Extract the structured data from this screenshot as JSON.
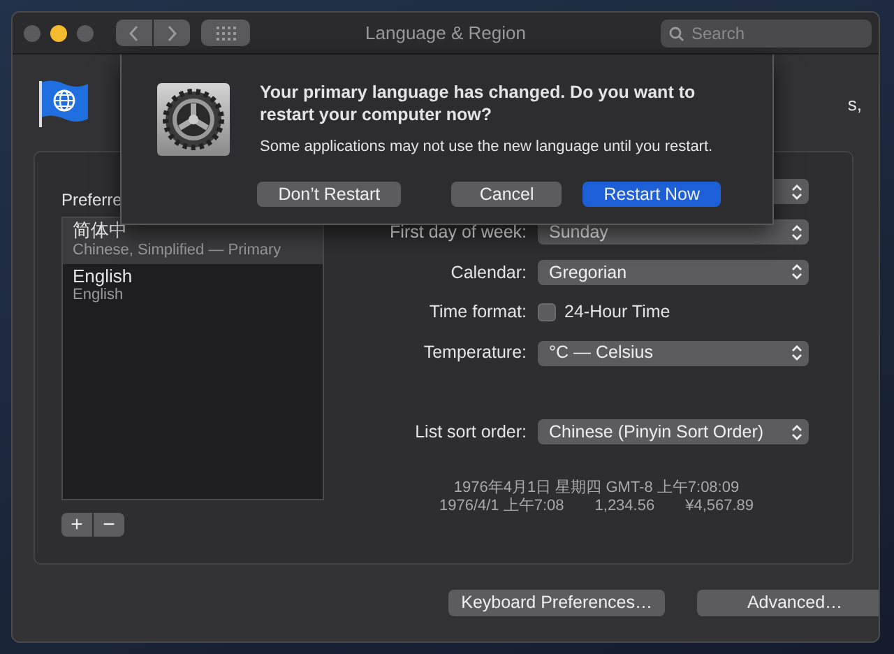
{
  "window": {
    "title": "Language & Region",
    "traffic_lights": [
      {
        "color": "#5b5b5d"
      },
      {
        "color": "#f4bb2f"
      },
      {
        "color": "#5b5b5d"
      }
    ]
  },
  "toolbar": {
    "search": {
      "placeholder": "Search"
    }
  },
  "header": {
    "text_fragment": "s,"
  },
  "languages": {
    "label": "Preferre",
    "items": [
      {
        "name": "简体中",
        "detail": "Chinese, Simplified — Primary",
        "selected": true
      },
      {
        "name": "English",
        "detail": "English",
        "selected": false
      }
    ],
    "buttons": [
      "+",
      "−"
    ]
  },
  "settings": [
    {
      "kind": "popup"
    },
    {
      "kind": "popup",
      "label": "First day of week:",
      "value": "Sunday"
    },
    {
      "kind": "popup",
      "label": "Calendar:",
      "value": "Gregorian"
    },
    {
      "kind": "checkbox",
      "label": "Time format:",
      "value": "24-Hour Time",
      "checked": false
    },
    {
      "kind": "popup",
      "label": "Temperature:",
      "value": "°C — Celsius"
    }
  ],
  "sort_order": {
    "label": "List sort order:",
    "value": "Chinese (Pinyin Sort Order)"
  },
  "samples": {
    "line_1": "1976年4月1日 星期四 GMT-8 上午7:08:09",
    "line_2": [
      "1976/4/1 上午7:08",
      "1,234.56",
      "¥4,567.89"
    ]
  },
  "footer_buttons": [
    "Keyboard Preferences…",
    "Advanced…"
  ],
  "dialog": {
    "title": "Your primary language has changed. Do you want to restart your computer now?",
    "message": "Some applications may not use the new language until you restart.",
    "buttons": [
      {
        "label": "Don’t Restart",
        "default": false
      },
      {
        "label": "Cancel",
        "default": false
      },
      {
        "label": "Restart Now",
        "default": true
      }
    ]
  }
}
